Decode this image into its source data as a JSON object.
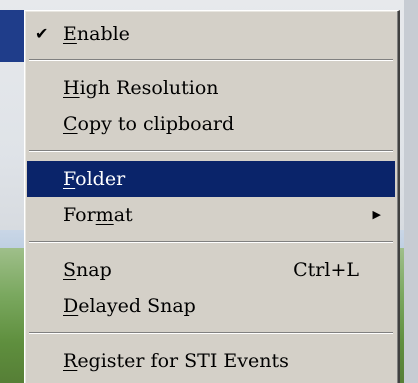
{
  "menu": {
    "items": [
      {
        "id": "enable",
        "pre": "",
        "mnemonic": "E",
        "post": "nable",
        "checked": true,
        "check_glyph": "✔"
      },
      {
        "id": "high-resolution",
        "pre": "",
        "mnemonic": "H",
        "post": "igh Resolution"
      },
      {
        "id": "copy-to-clipboard",
        "pre": "",
        "mnemonic": "C",
        "post": "opy to clipboard"
      },
      {
        "id": "folder",
        "pre": "",
        "mnemonic": "F",
        "post": "older",
        "selected": true
      },
      {
        "id": "format",
        "pre": "For",
        "mnemonic": "m",
        "post": "at",
        "submenu_glyph": "▶"
      },
      {
        "id": "snap",
        "pre": "",
        "mnemonic": "S",
        "post": "nap",
        "shortcut": "Ctrl+L"
      },
      {
        "id": "delayed-snap",
        "pre": "",
        "mnemonic": "D",
        "post": "elayed Snap"
      },
      {
        "id": "register-sti",
        "pre": "",
        "mnemonic": "R",
        "post": "egister for STI Events"
      }
    ]
  },
  "colors": {
    "menu_bg": "#d4d0c8",
    "highlight_bg": "#0a246a",
    "highlight_text": "#ffffff"
  }
}
